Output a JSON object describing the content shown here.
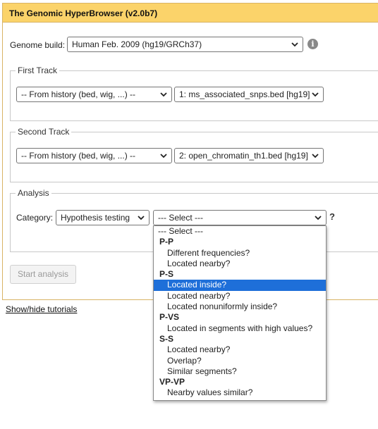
{
  "app": {
    "title": "The Genomic HyperBrowser (v2.0b7)"
  },
  "genome": {
    "label": "Genome build:",
    "selected": "Human Feb. 2009 (hg19/GRCh37)",
    "info_icon": "info-icon"
  },
  "first_track": {
    "legend": "First Track",
    "source": "-- From history (bed, wig, ...) --",
    "dataset": "1: ms_associated_snps.bed [hg19]"
  },
  "second_track": {
    "legend": "Second Track",
    "source": "-- From history (bed, wig, ...) --",
    "dataset": "2: open_chromatin_th1.bed [hg19]"
  },
  "analysis": {
    "legend": "Analysis",
    "category_label": "Category:",
    "category_selected": "Hypothesis testing",
    "question_selected": "--- Select ---",
    "help_mark": "?"
  },
  "dropdown": {
    "options": [
      {
        "kind": "top",
        "text": "--- Select ---"
      },
      {
        "kind": "group",
        "text": "P-P"
      },
      {
        "kind": "item",
        "text": "Different frequencies?"
      },
      {
        "kind": "item",
        "text": "Located nearby?"
      },
      {
        "kind": "group",
        "text": "P-S"
      },
      {
        "kind": "item",
        "text": "Located inside?",
        "highlighted": true
      },
      {
        "kind": "item",
        "text": "Located nearby?"
      },
      {
        "kind": "item",
        "text": "Located nonuniformly inside?"
      },
      {
        "kind": "group",
        "text": "P-VS"
      },
      {
        "kind": "item",
        "text": "Located in segments with high values?"
      },
      {
        "kind": "group",
        "text": "S-S"
      },
      {
        "kind": "item",
        "text": "Located nearby?"
      },
      {
        "kind": "item",
        "text": "Overlap?"
      },
      {
        "kind": "item",
        "text": "Similar segments?"
      },
      {
        "kind": "group",
        "text": "VP-VP"
      },
      {
        "kind": "item",
        "text": "Nearby values similar?"
      }
    ]
  },
  "buttons": {
    "start": "Start analysis"
  },
  "links": {
    "tutorials": "Show/hide tutorials"
  },
  "colors": {
    "header": "#fbd36a",
    "border": "#d8b365",
    "highlight": "#1e6fd9"
  }
}
